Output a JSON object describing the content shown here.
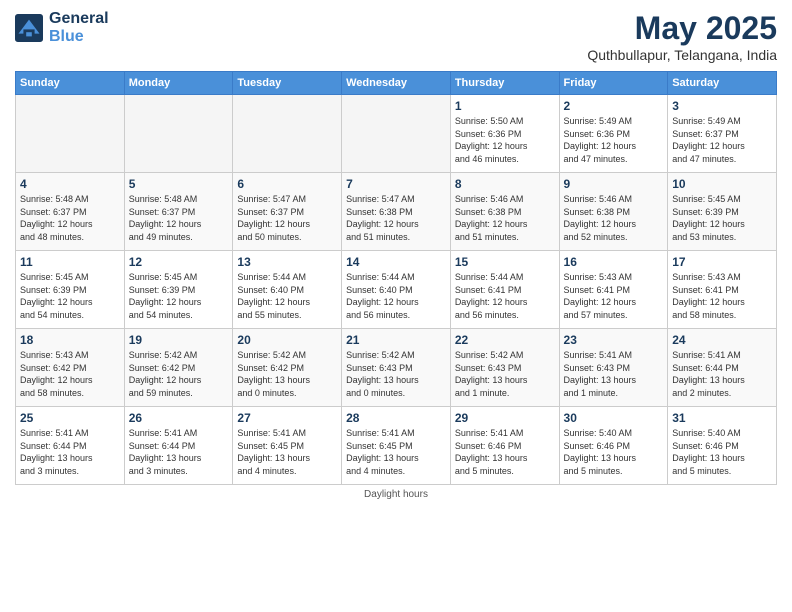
{
  "logo": {
    "line1": "General",
    "line2": "Blue"
  },
  "title": "May 2025",
  "subtitle": "Quthbullapur, Telangana, India",
  "weekdays": [
    "Sunday",
    "Monday",
    "Tuesday",
    "Wednesday",
    "Thursday",
    "Friday",
    "Saturday"
  ],
  "footer": "Daylight hours",
  "weeks": [
    [
      {
        "day": "",
        "info": ""
      },
      {
        "day": "",
        "info": ""
      },
      {
        "day": "",
        "info": ""
      },
      {
        "day": "",
        "info": ""
      },
      {
        "day": "1",
        "info": "Sunrise: 5:50 AM\nSunset: 6:36 PM\nDaylight: 12 hours\nand 46 minutes."
      },
      {
        "day": "2",
        "info": "Sunrise: 5:49 AM\nSunset: 6:36 PM\nDaylight: 12 hours\nand 47 minutes."
      },
      {
        "day": "3",
        "info": "Sunrise: 5:49 AM\nSunset: 6:37 PM\nDaylight: 12 hours\nand 47 minutes."
      }
    ],
    [
      {
        "day": "4",
        "info": "Sunrise: 5:48 AM\nSunset: 6:37 PM\nDaylight: 12 hours\nand 48 minutes."
      },
      {
        "day": "5",
        "info": "Sunrise: 5:48 AM\nSunset: 6:37 PM\nDaylight: 12 hours\nand 49 minutes."
      },
      {
        "day": "6",
        "info": "Sunrise: 5:47 AM\nSunset: 6:37 PM\nDaylight: 12 hours\nand 50 minutes."
      },
      {
        "day": "7",
        "info": "Sunrise: 5:47 AM\nSunset: 6:38 PM\nDaylight: 12 hours\nand 51 minutes."
      },
      {
        "day": "8",
        "info": "Sunrise: 5:46 AM\nSunset: 6:38 PM\nDaylight: 12 hours\nand 51 minutes."
      },
      {
        "day": "9",
        "info": "Sunrise: 5:46 AM\nSunset: 6:38 PM\nDaylight: 12 hours\nand 52 minutes."
      },
      {
        "day": "10",
        "info": "Sunrise: 5:45 AM\nSunset: 6:39 PM\nDaylight: 12 hours\nand 53 minutes."
      }
    ],
    [
      {
        "day": "11",
        "info": "Sunrise: 5:45 AM\nSunset: 6:39 PM\nDaylight: 12 hours\nand 54 minutes."
      },
      {
        "day": "12",
        "info": "Sunrise: 5:45 AM\nSunset: 6:39 PM\nDaylight: 12 hours\nand 54 minutes."
      },
      {
        "day": "13",
        "info": "Sunrise: 5:44 AM\nSunset: 6:40 PM\nDaylight: 12 hours\nand 55 minutes."
      },
      {
        "day": "14",
        "info": "Sunrise: 5:44 AM\nSunset: 6:40 PM\nDaylight: 12 hours\nand 56 minutes."
      },
      {
        "day": "15",
        "info": "Sunrise: 5:44 AM\nSunset: 6:41 PM\nDaylight: 12 hours\nand 56 minutes."
      },
      {
        "day": "16",
        "info": "Sunrise: 5:43 AM\nSunset: 6:41 PM\nDaylight: 12 hours\nand 57 minutes."
      },
      {
        "day": "17",
        "info": "Sunrise: 5:43 AM\nSunset: 6:41 PM\nDaylight: 12 hours\nand 58 minutes."
      }
    ],
    [
      {
        "day": "18",
        "info": "Sunrise: 5:43 AM\nSunset: 6:42 PM\nDaylight: 12 hours\nand 58 minutes."
      },
      {
        "day": "19",
        "info": "Sunrise: 5:42 AM\nSunset: 6:42 PM\nDaylight: 12 hours\nand 59 minutes."
      },
      {
        "day": "20",
        "info": "Sunrise: 5:42 AM\nSunset: 6:42 PM\nDaylight: 13 hours\nand 0 minutes."
      },
      {
        "day": "21",
        "info": "Sunrise: 5:42 AM\nSunset: 6:43 PM\nDaylight: 13 hours\nand 0 minutes."
      },
      {
        "day": "22",
        "info": "Sunrise: 5:42 AM\nSunset: 6:43 PM\nDaylight: 13 hours\nand 1 minute."
      },
      {
        "day": "23",
        "info": "Sunrise: 5:41 AM\nSunset: 6:43 PM\nDaylight: 13 hours\nand 1 minute."
      },
      {
        "day": "24",
        "info": "Sunrise: 5:41 AM\nSunset: 6:44 PM\nDaylight: 13 hours\nand 2 minutes."
      }
    ],
    [
      {
        "day": "25",
        "info": "Sunrise: 5:41 AM\nSunset: 6:44 PM\nDaylight: 13 hours\nand 3 minutes."
      },
      {
        "day": "26",
        "info": "Sunrise: 5:41 AM\nSunset: 6:44 PM\nDaylight: 13 hours\nand 3 minutes."
      },
      {
        "day": "27",
        "info": "Sunrise: 5:41 AM\nSunset: 6:45 PM\nDaylight: 13 hours\nand 4 minutes."
      },
      {
        "day": "28",
        "info": "Sunrise: 5:41 AM\nSunset: 6:45 PM\nDaylight: 13 hours\nand 4 minutes."
      },
      {
        "day": "29",
        "info": "Sunrise: 5:41 AM\nSunset: 6:46 PM\nDaylight: 13 hours\nand 5 minutes."
      },
      {
        "day": "30",
        "info": "Sunrise: 5:40 AM\nSunset: 6:46 PM\nDaylight: 13 hours\nand 5 minutes."
      },
      {
        "day": "31",
        "info": "Sunrise: 5:40 AM\nSunset: 6:46 PM\nDaylight: 13 hours\nand 5 minutes."
      }
    ]
  ]
}
